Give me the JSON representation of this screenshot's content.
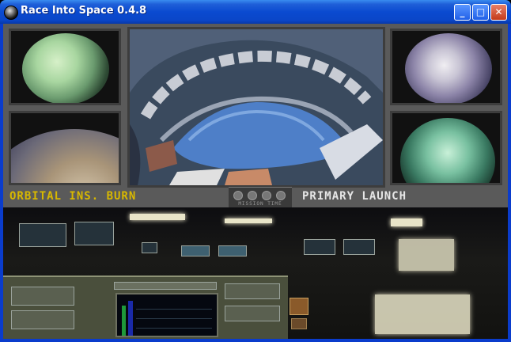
{
  "window": {
    "title": "Race Into Space 0.4.8",
    "minimize_symbol": "_",
    "maximize_symbol": "□",
    "close_symbol": "✕"
  },
  "hud": {
    "current_step": "ORBITAL INS. BURN",
    "mission_type": "PRIMARY LAUNCH",
    "timer_label": "MISSION TIME"
  },
  "colors": {
    "current_step_color": "#d8b800",
    "mission_type_color": "#e6e6e6",
    "titlebar_blue": "#0a4ad0",
    "close_red": "#c43a1a"
  }
}
